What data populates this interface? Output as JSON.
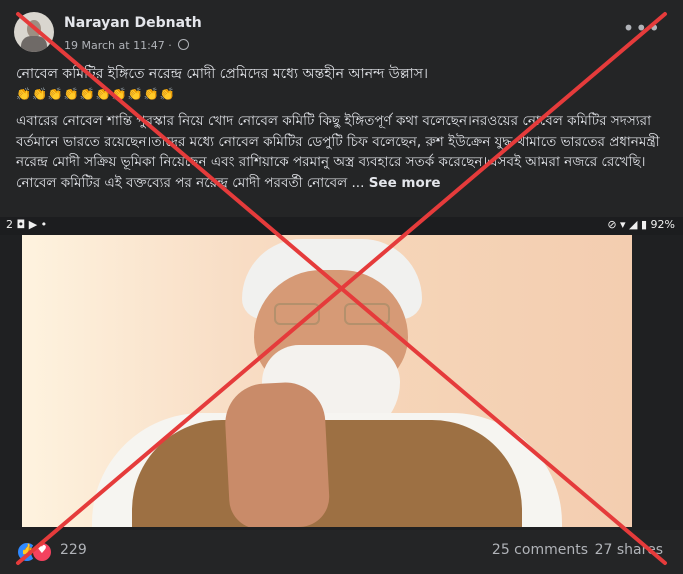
{
  "post": {
    "author": "Narayan Debnath",
    "date": "19 March at 11:47",
    "separator": "·",
    "more_icon": "more-dots-icon",
    "title": "নোবেল কমিটির ইঙ্গিতে নরেন্দ্র মোদী প্রেমিদের মধ্যে অন্তহীন আনন্দ উল্লাস।",
    "emojis": "👏👏👏👏👏👏👏👏👏👏",
    "body": "এবারের নোবেল শান্তি পুরস্কার নিয়ে খোদ নোবেল কমিটি কিছু ইঙ্গিতপূর্ণ কথা বলেছেন।নরওয়ের নোবেল কমিটির সদস্যরা বর্তমানে ভারতে রয়েছেন।তাদের মধ্যে নোবেল কমিটির ডেপুটি চিফ বলেছেন, রুশ ইউক্রেন যুদ্ধ থামাতে ভারতের প্রধানমন্ত্রী নরেন্দ্র মোদী সক্রিয় ভূমিকা নিয়েছেন এবং রাশিয়াকে পরমানু অস্ত্র ব্যবহারে সতর্ক করেছেন।এসবই আমরা নজরে রেখেছি।নোবেল কমিটির এই বক্তব্যের পর নরেন্দ্র মোদী পরবর্তী নোবেল ...",
    "see_more": "See more"
  },
  "status_strip": {
    "left": "2 ◘ ▶ •",
    "right": "⊘ ▾ ◢ ▮ 92%"
  },
  "footer": {
    "reactions_count": "229",
    "comments": "25 comments",
    "shares": "27 shares"
  },
  "overlay": {
    "cross_color": "#e53b3b"
  }
}
